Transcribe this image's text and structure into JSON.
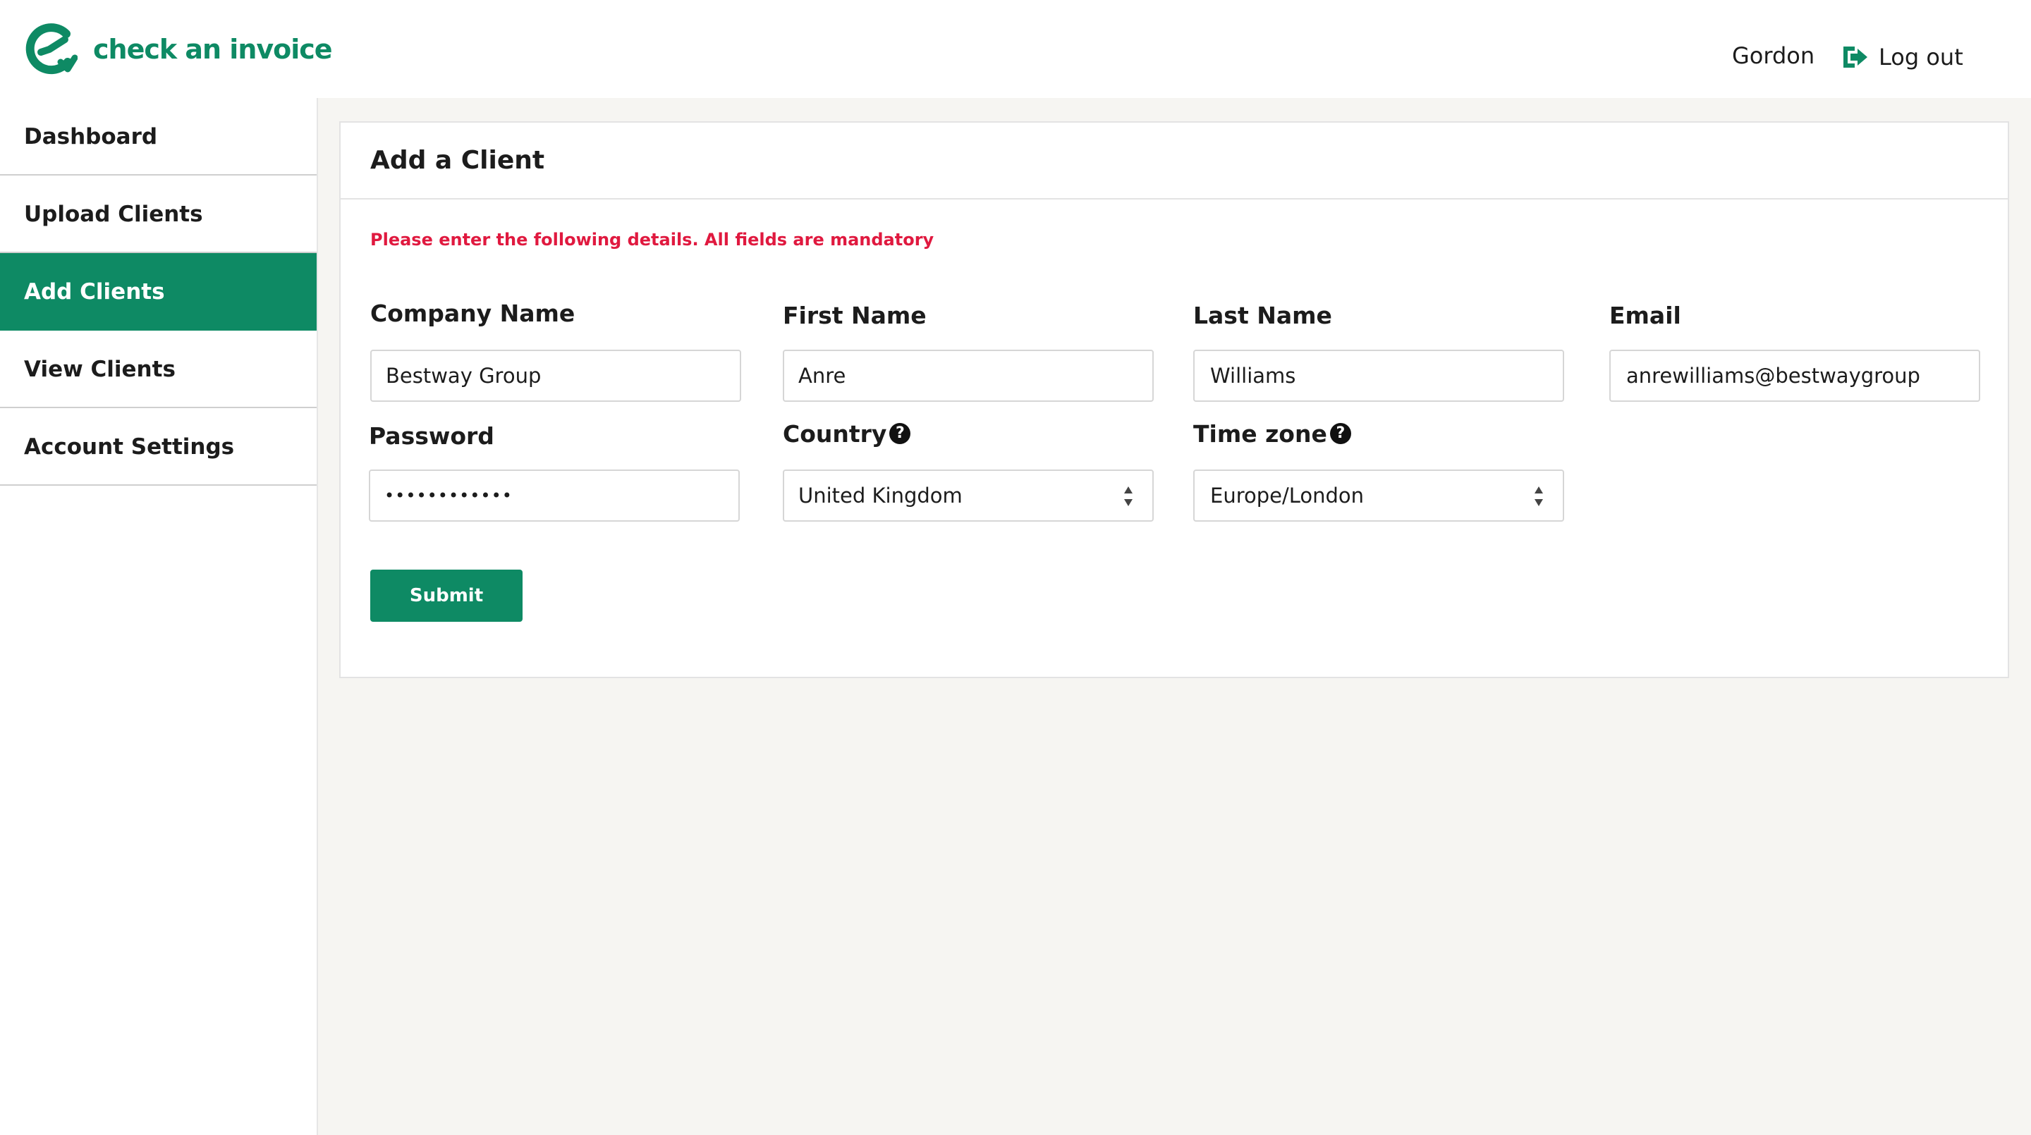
{
  "header": {
    "logo_text": "check an invoice",
    "brand_color": "#0e8a64",
    "user_name": "Gordon",
    "logout_label": "Log out"
  },
  "sidebar": {
    "items": [
      {
        "label": "Dashboard",
        "active": false
      },
      {
        "label": "Upload Clients",
        "active": false
      },
      {
        "label": "Add Clients",
        "active": true
      },
      {
        "label": "View Clients",
        "active": false
      },
      {
        "label": "Account Settings",
        "active": false
      }
    ]
  },
  "form": {
    "title": "Add a Client",
    "notice": "Please enter the  following details. All fields are mandatory",
    "notice_color": "#e0193f",
    "fields": {
      "company_name": {
        "label": "Company Name",
        "value": "Bestway Group"
      },
      "first_name": {
        "label": "First Name",
        "value": "Anre"
      },
      "last_name": {
        "label": "Last Name",
        "value": "Williams"
      },
      "email": {
        "label": "Email",
        "value": "anrewilliams@bestwaygroup"
      },
      "password": {
        "label": "Password",
        "value": "••••••••••••"
      },
      "country": {
        "label": "Country",
        "value": "United Kingdom"
      },
      "timezone": {
        "label": "Time zone",
        "value": "Europe/London"
      }
    },
    "submit_label": "Submit"
  }
}
